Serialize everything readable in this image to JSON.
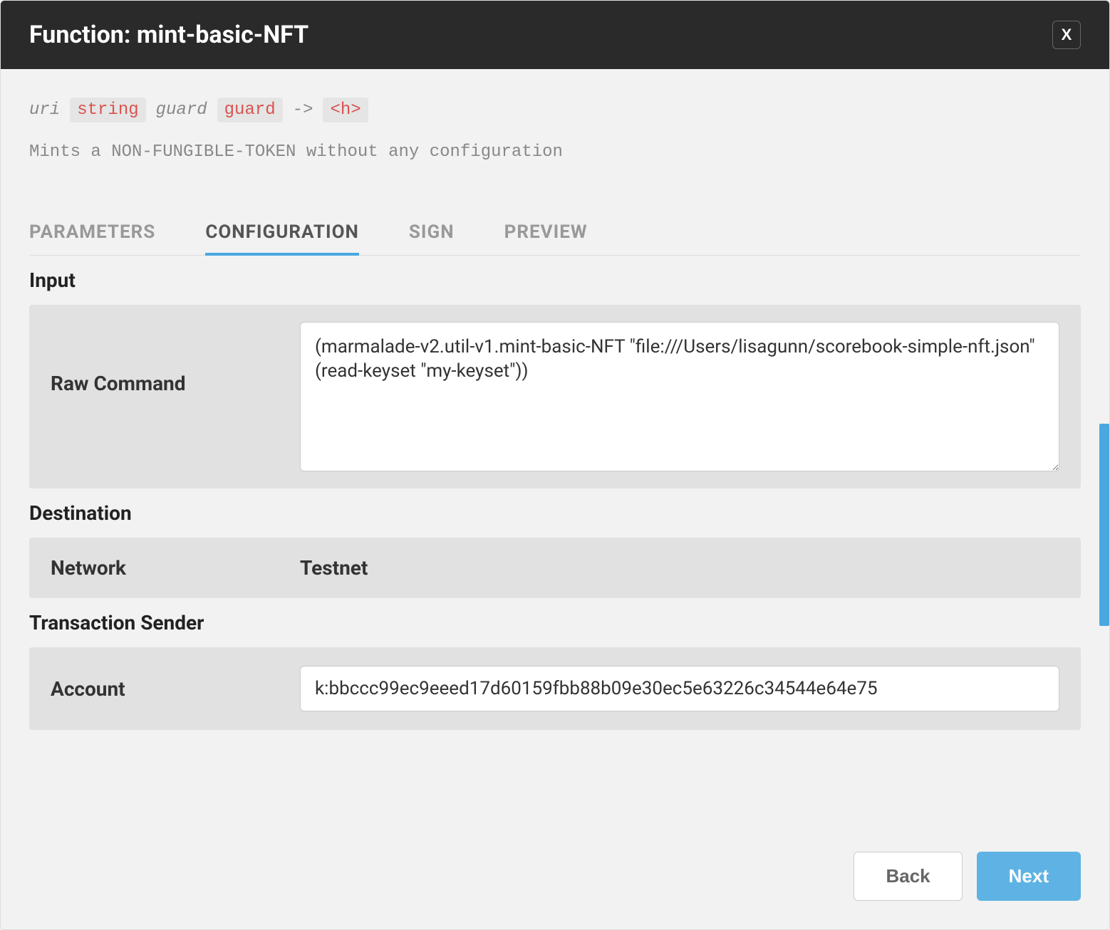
{
  "header": {
    "title": "Function: mint-basic-NFT",
    "close_label": "X"
  },
  "signature": {
    "params": [
      {
        "name": "uri",
        "type": "string"
      },
      {
        "name": "guard",
        "type": "guard"
      }
    ],
    "arrow": "->",
    "return": "<h>"
  },
  "description": "Mints a NON-FUNGIBLE-TOKEN without any configuration",
  "tabs": [
    {
      "id": "parameters",
      "label": "PARAMETERS",
      "active": false
    },
    {
      "id": "configuration",
      "label": "CONFIGURATION",
      "active": true
    },
    {
      "id": "sign",
      "label": "SIGN",
      "active": false
    },
    {
      "id": "preview",
      "label": "PREVIEW",
      "active": false
    }
  ],
  "sections": {
    "input": {
      "title": "Input",
      "raw_command_label": "Raw Command",
      "raw_command_value": "(marmalade-v2.util-v1.mint-basic-NFT \"file:///Users/lisagunn/scorebook-simple-nft.json\" (read-keyset \"my-keyset\"))"
    },
    "destination": {
      "title": "Destination",
      "network_label": "Network",
      "network_value": "Testnet"
    },
    "transaction_sender": {
      "title": "Transaction Sender",
      "account_label": "Account",
      "account_value": "k:bbccc99ec9eeed17d60159fbb88b09e30ec5e63226c34544e64e75"
    }
  },
  "footer": {
    "back_label": "Back",
    "next_label": "Next"
  }
}
